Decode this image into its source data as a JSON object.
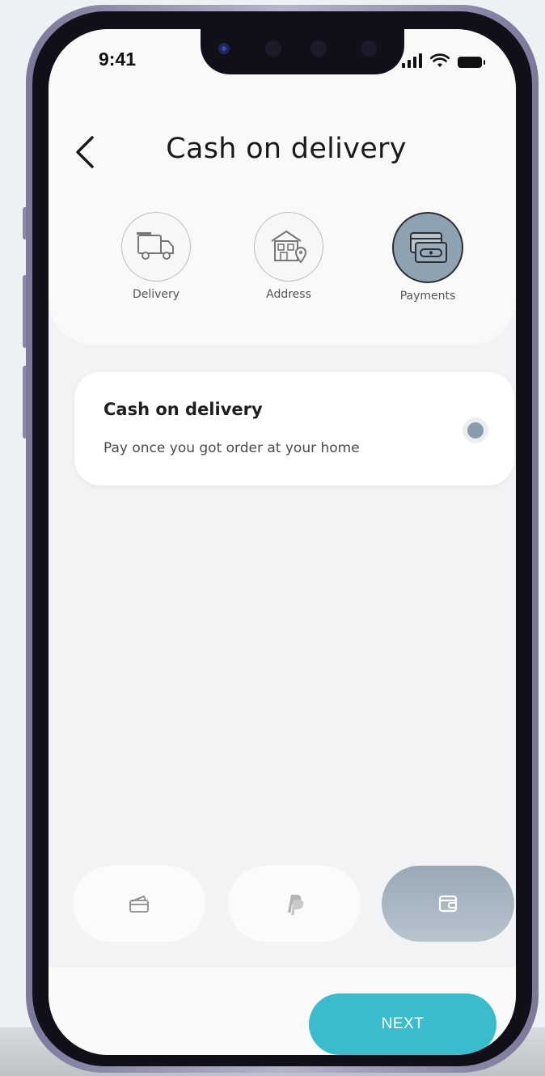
{
  "status_bar": {
    "time": "9:41"
  },
  "header": {
    "title": "Cash on delivery"
  },
  "steps": [
    {
      "label": "Delivery",
      "icon": "delivery-truck-icon",
      "active": false
    },
    {
      "label": "Address",
      "icon": "home-location-icon",
      "active": false
    },
    {
      "label": "Payments",
      "icon": "credit-card-icon",
      "active": true
    }
  ],
  "payment_option": {
    "title": "Cash on delivery",
    "description": "Pay once you got order at your home",
    "selected": true
  },
  "payment_methods": [
    {
      "icon": "card-icon",
      "active": false
    },
    {
      "icon": "paypal-icon",
      "active": false
    },
    {
      "icon": "wallet-icon",
      "active": true
    }
  ],
  "footer": {
    "next_label": "NEXT"
  },
  "colors": {
    "accent": "#3bbccc",
    "active_step": "#8fa2b1",
    "active_method": "#9aa9b7",
    "background": "#f1f3f4"
  }
}
